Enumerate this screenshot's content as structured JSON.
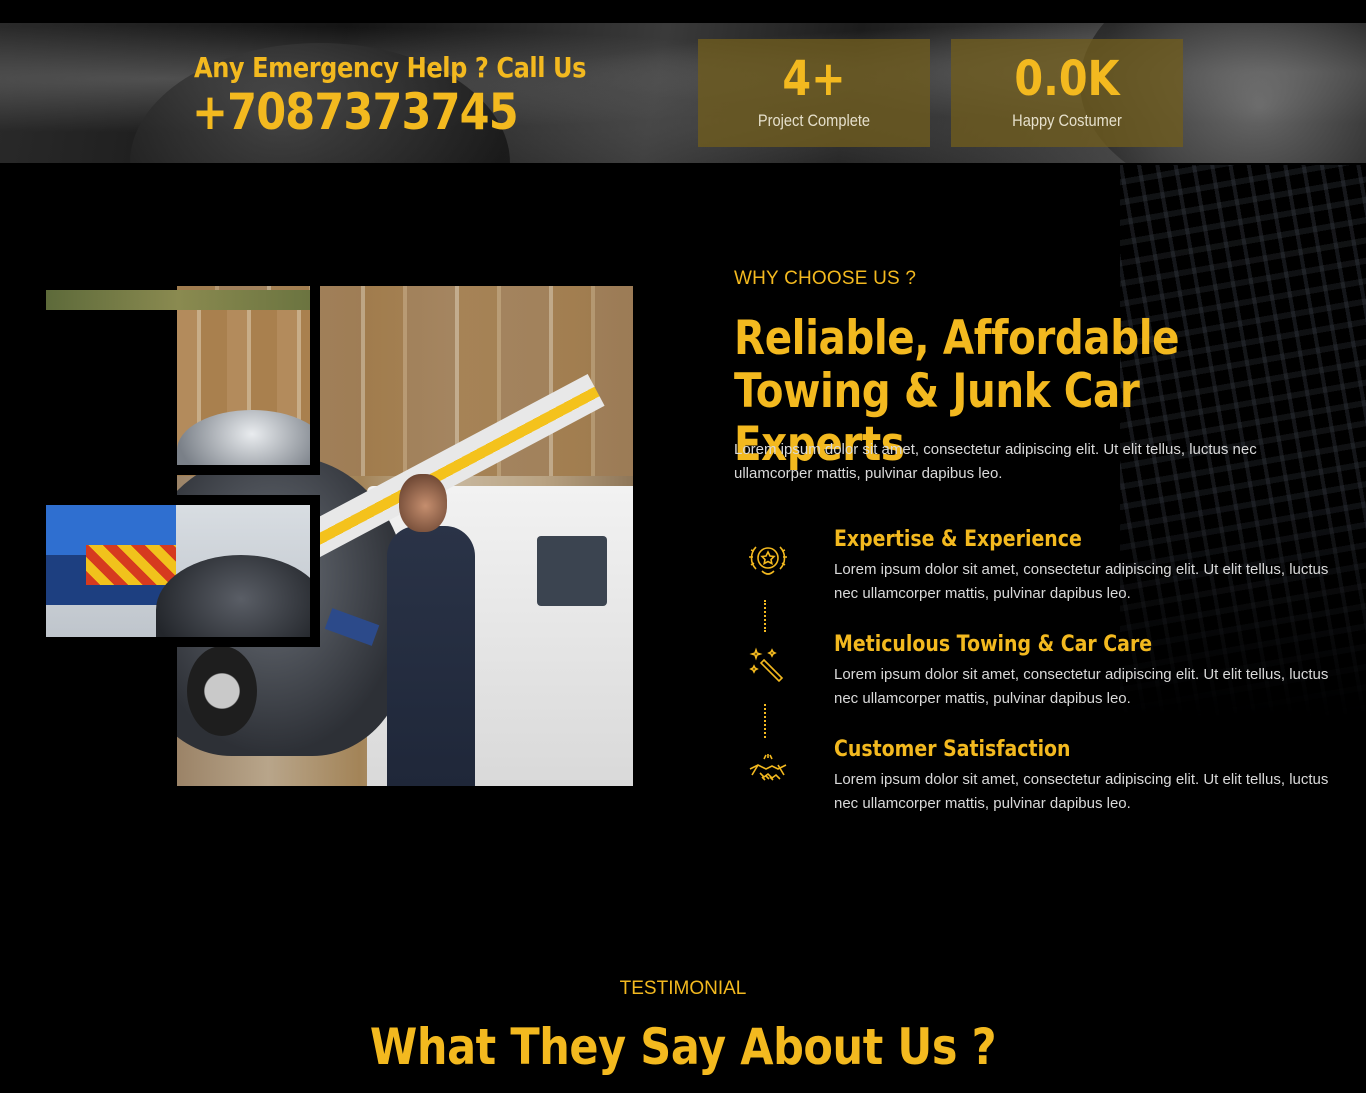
{
  "emergency": {
    "title": "Any Emergency Help ? Call Us",
    "phone": "+7087373745"
  },
  "stats": [
    {
      "value": "4+",
      "label": "Project Complete"
    },
    {
      "value": "0.0K",
      "label": "Happy Costumer"
    }
  ],
  "why": {
    "label": "WHY CHOOSE US ?",
    "title": "Reliable, Affordable Towing & Junk Car Experts",
    "description": "Lorem ipsum dolor sit amet, consectetur adipiscing elit. Ut elit tellus, luctus nec ullamcorper mattis, pulvinar dapibus leo.",
    "features": [
      {
        "icon": "award-badge-icon",
        "title": "Expertise & Experience",
        "description": "Lorem ipsum dolor sit amet, consectetur adipiscing elit. Ut elit tellus, luctus nec ullamcorper mattis, pulvinar dapibus leo."
      },
      {
        "icon": "magic-wand-icon",
        "title": "Meticulous Towing & Car Care",
        "description": "Lorem ipsum dolor sit amet, consectetur adipiscing elit. Ut elit tellus, luctus nec ullamcorper mattis, pulvinar dapibus leo."
      },
      {
        "icon": "handshake-icon",
        "title": "Customer Satisfaction",
        "description": "Lorem ipsum dolor sit amet, consectetur adipiscing elit. Ut elit tellus, luctus nec ullamcorper mattis, pulvinar dapibus leo."
      }
    ]
  },
  "testimonial": {
    "label": "TESTIMONIAL",
    "title": "What They Say About Us ?"
  },
  "colors": {
    "accent": "#f3b91f",
    "background": "#000000",
    "stat_box": "#6f5c1e"
  }
}
